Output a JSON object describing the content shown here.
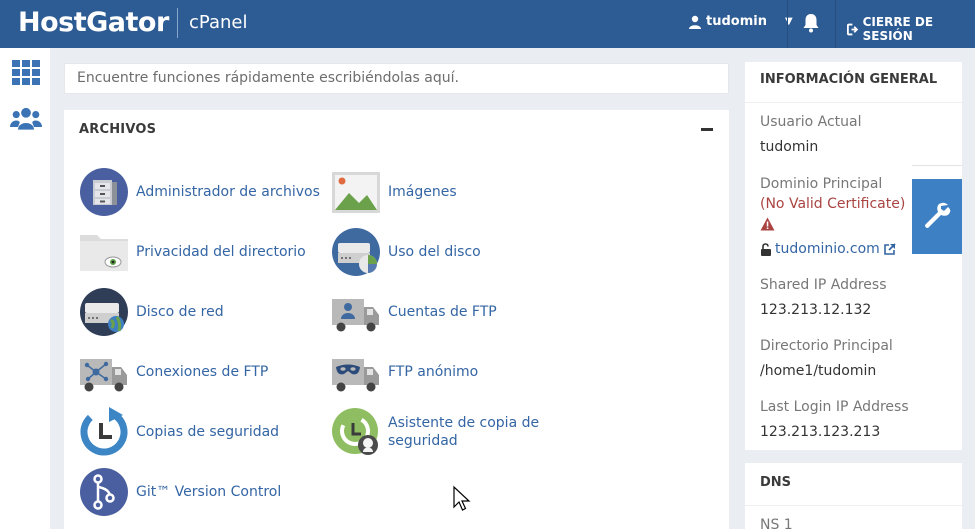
{
  "header": {
    "brand": "HostGator",
    "product": "cPanel",
    "username": "tudomin",
    "logout_label": "CIERRE DE SESIÓN",
    "bg_color": "#2d5b93"
  },
  "sidebar": {
    "items": [
      {
        "icon": "grid-icon"
      },
      {
        "icon": "users-icon"
      }
    ]
  },
  "search": {
    "placeholder": "Encuentre funciones rápidamente escribiéndolas aquí."
  },
  "files_panel": {
    "title": "ARCHIVOS",
    "items": [
      {
        "label": "Administrador de archivos",
        "icon": "file-cabinet-icon"
      },
      {
        "label": "Imágenes",
        "icon": "image-icon"
      },
      {
        "label": "Privacidad del directorio",
        "icon": "folder-privacy-icon"
      },
      {
        "label": "Uso del disco",
        "icon": "disk-usage-icon"
      },
      {
        "label": "Disco de red",
        "icon": "network-disk-icon"
      },
      {
        "label": "Cuentas de FTP",
        "icon": "ftp-accounts-icon"
      },
      {
        "label": "Conexiones de FTP",
        "icon": "ftp-connections-icon"
      },
      {
        "label": "FTP anónimo",
        "icon": "anonymous-ftp-icon"
      },
      {
        "label": "Copias de seguridad",
        "icon": "backup-icon"
      },
      {
        "label": "Asistente de copia de seguridad",
        "icon": "backup-wizard-icon"
      },
      {
        "label": "Git™ Version Control",
        "icon": "git-icon"
      }
    ]
  },
  "general_info": {
    "title": "INFORMACIÓN GENERAL",
    "current_user_label": "Usuario Actual",
    "current_user": "tudomin",
    "main_domain_label": "Dominio Principal",
    "certificate_warning": "(No Valid Certificate)",
    "domain": "tudominio.com",
    "shared_ip_label": "Shared IP Address",
    "shared_ip": "123.213.12.132",
    "home_dir_label": "Directorio Principal",
    "home_dir": "/home1/tudomin",
    "last_login_label": "Last Login IP Address",
    "last_login_ip": "123.213.123.213"
  },
  "dns_panel": {
    "title": "DNS",
    "ns1_label": "NS 1"
  }
}
